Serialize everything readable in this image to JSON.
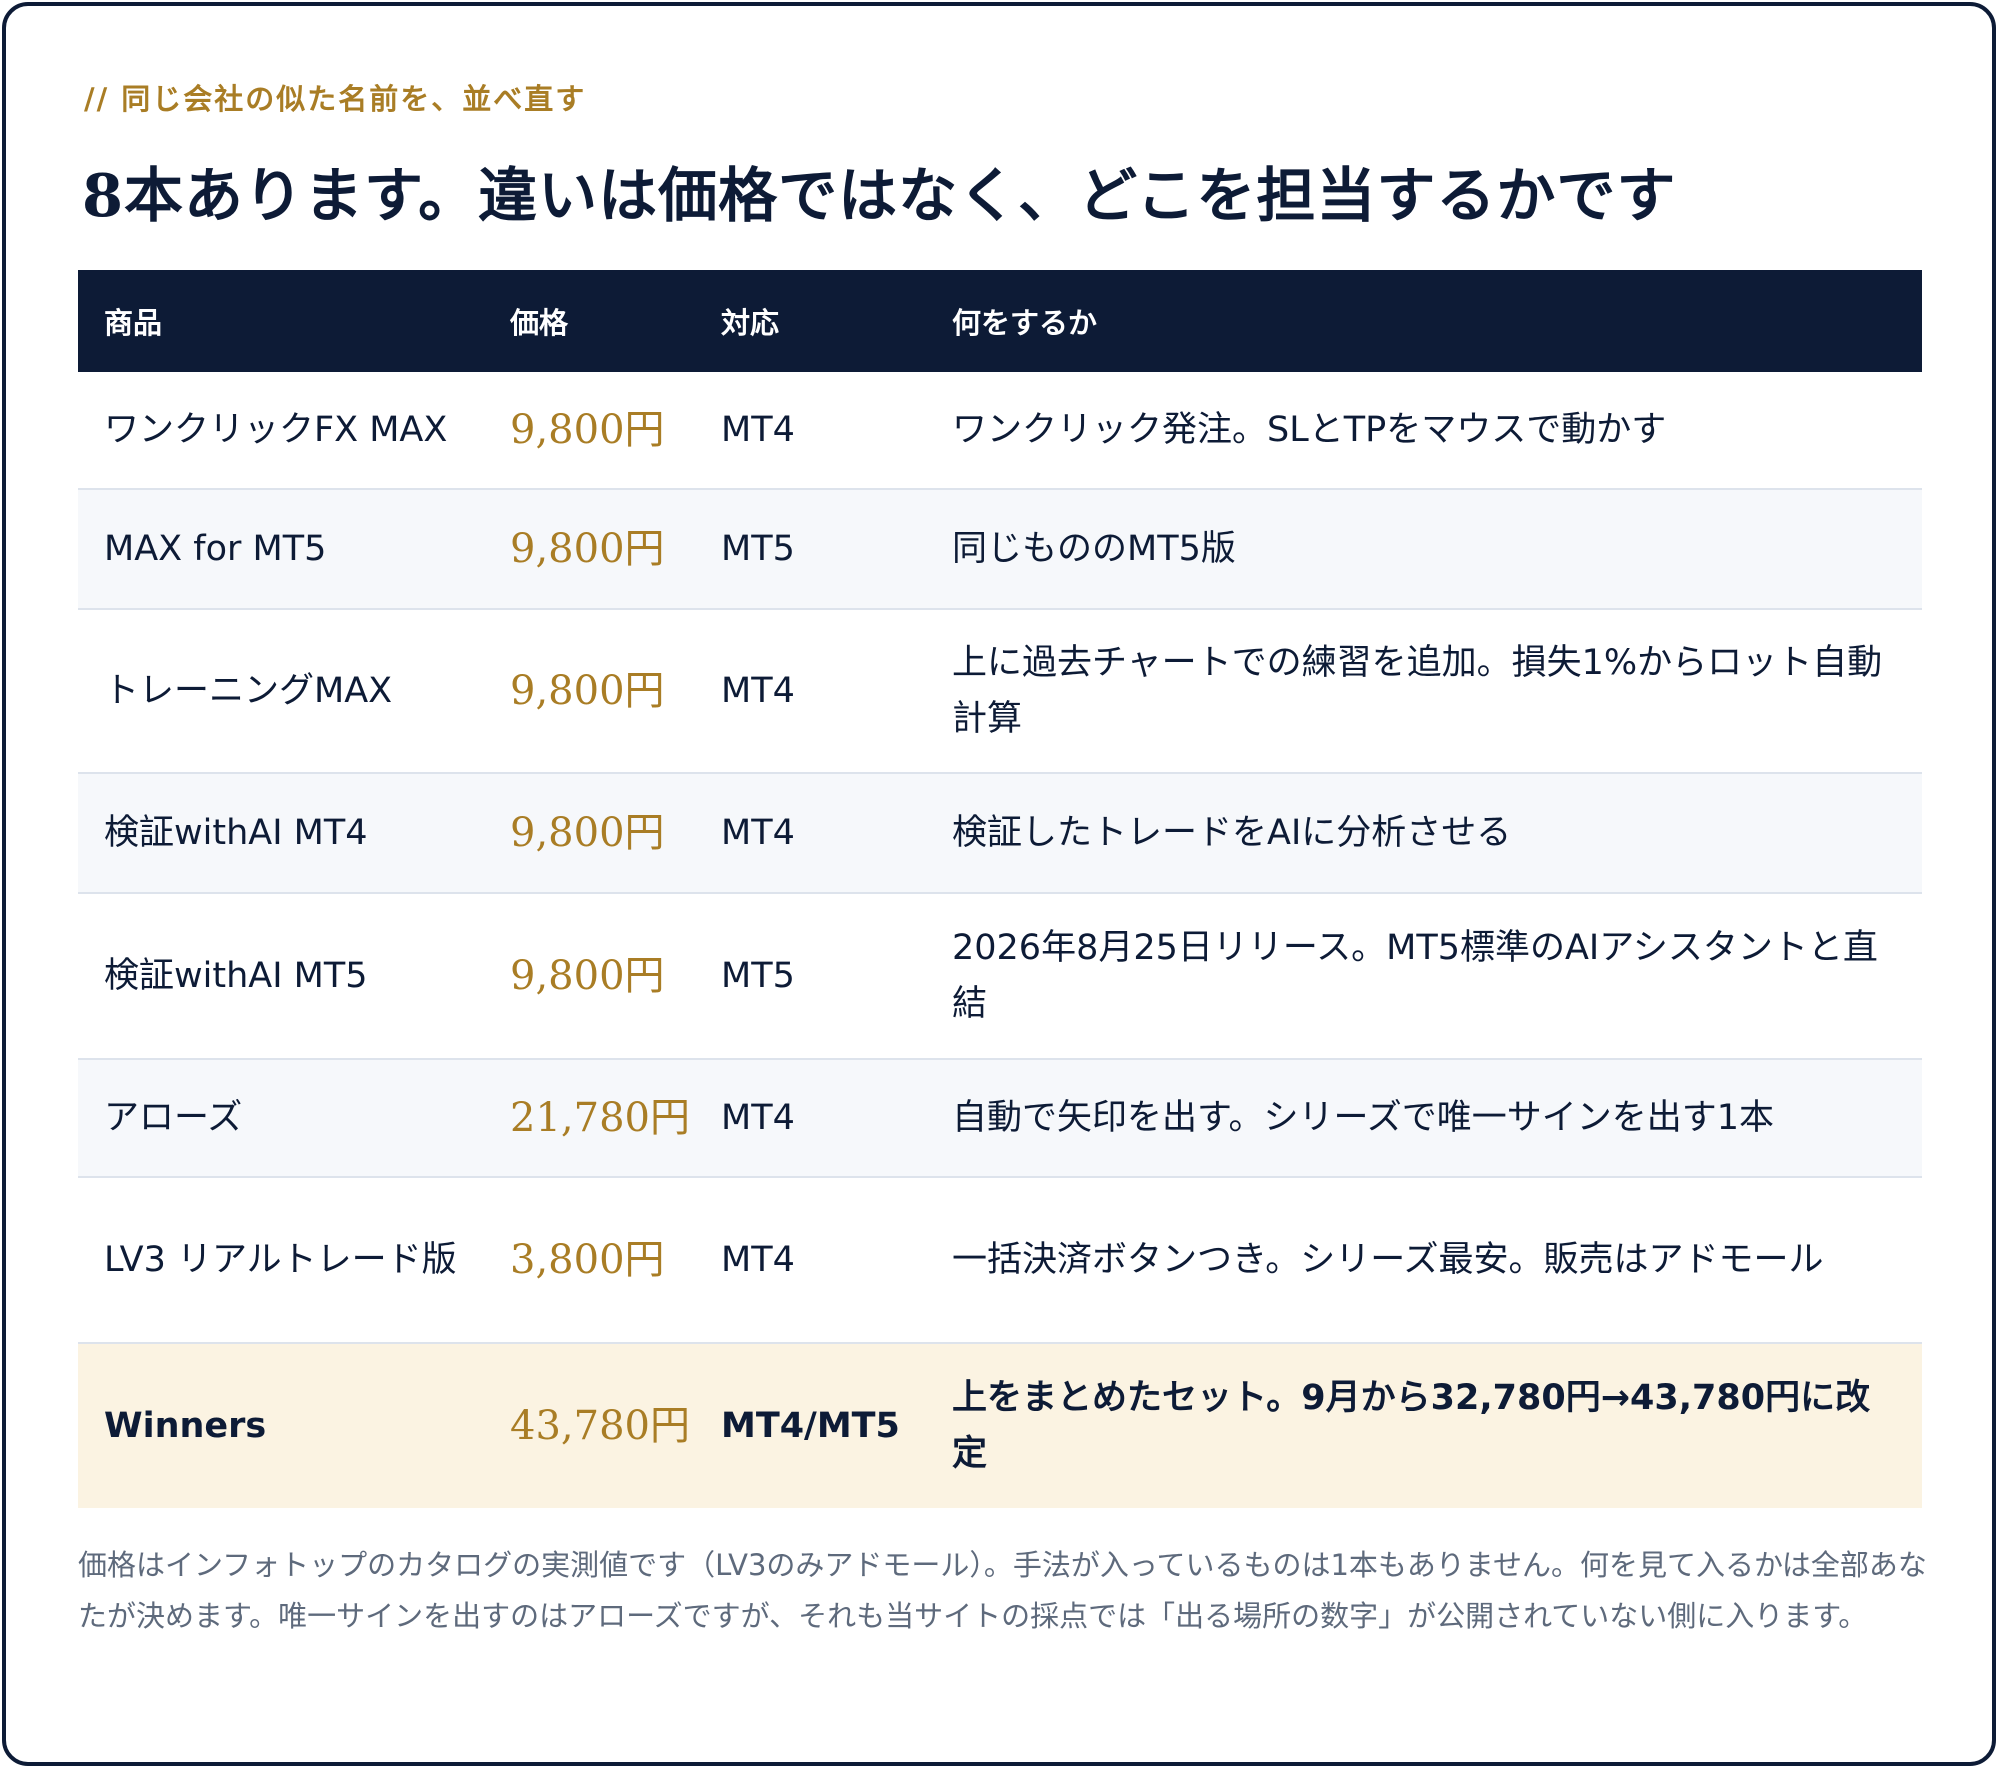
{
  "eyebrow": "// 同じ会社の似た名前を、並べ直す",
  "title": "8本あります。違いは価格ではなく、どこを担当するかです",
  "table": {
    "headers": [
      "商品",
      "価格",
      "対応",
      "何をするか"
    ],
    "rows": [
      {
        "product": "ワンクリックFX MAX",
        "price": "9,800円",
        "platform": "MT4",
        "description": "ワンクリック発注。SLとTPをマウスで動かす"
      },
      {
        "product": "MAX for MT5",
        "price": "9,800円",
        "platform": "MT5",
        "description": "同じもののMT5版"
      },
      {
        "product": "トレーニングMAX",
        "price": "9,800円",
        "platform": "MT4",
        "description": "上に過去チャートでの練習を追加。損失1%からロット自動計算"
      },
      {
        "product": "検証withAI MT4",
        "price": "9,800円",
        "platform": "MT4",
        "description": "検証したトレードをAIに分析させる"
      },
      {
        "product": "検証withAI MT5",
        "price": "9,800円",
        "platform": "MT5",
        "description": "2026年8月25日リリース。MT5標準のAIアシスタントと直結"
      },
      {
        "product": "アローズ",
        "price": "21,780円",
        "platform": "MT4",
        "description": "自動で矢印を出す。シリーズで唯一サインを出す1本"
      },
      {
        "product": "LV3 リアルトレード版",
        "price": "3,800円",
        "platform": "MT4",
        "description": "一括決済ボタンつき。シリーズ最安。販売はアドモール"
      },
      {
        "product": "Winners",
        "price": "43,780円",
        "platform": "MT4/MT5",
        "description": "上をまとめたセット。9月から32,780円→43,780円に改定"
      }
    ]
  },
  "note": "価格はインフォトップのカタログの実測値です（LV3のみアドモール）。手法が入っているものは1本もありません。何を見て入るかは全部あなたが決めます。唯一サインを出すのはアローズですが、それも当サイトの採点では「出る場所の数字」が公開されていない側に入ります。",
  "colors": {
    "navy": "#0d1b36",
    "gold": "#a97d25",
    "highlight_row": "#fbf3e2",
    "alt_row": "#f6f8fb"
  }
}
